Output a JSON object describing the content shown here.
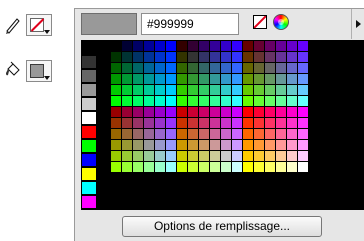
{
  "toolbar": {
    "stroke_tool_icon": "pencil-icon",
    "stroke_swatch": {
      "state": "no-color"
    },
    "fill_tool_icon": "paint-bucket-icon",
    "fill_swatch": {
      "color": "#999999"
    }
  },
  "panel": {
    "current_color": "#999999",
    "hex_value": "#999999",
    "no_color_icon": "no-color-icon",
    "color_picker_icon": "color-wheel-icon",
    "menu_icon": "menu-arrow-icon",
    "fill_options_button": "Options de remplissage...",
    "left_column_colors": [
      "#000000",
      "#333333",
      "#666666",
      "#999999",
      "#cccccc",
      "#ffffff",
      "#ff0000",
      "#00ff00",
      "#0000ff",
      "#ffff00",
      "#00ffff",
      "#ff00ff"
    ],
    "palette_shades": [
      "00",
      "33",
      "66",
      "99",
      "cc",
      "ff"
    ]
  }
}
